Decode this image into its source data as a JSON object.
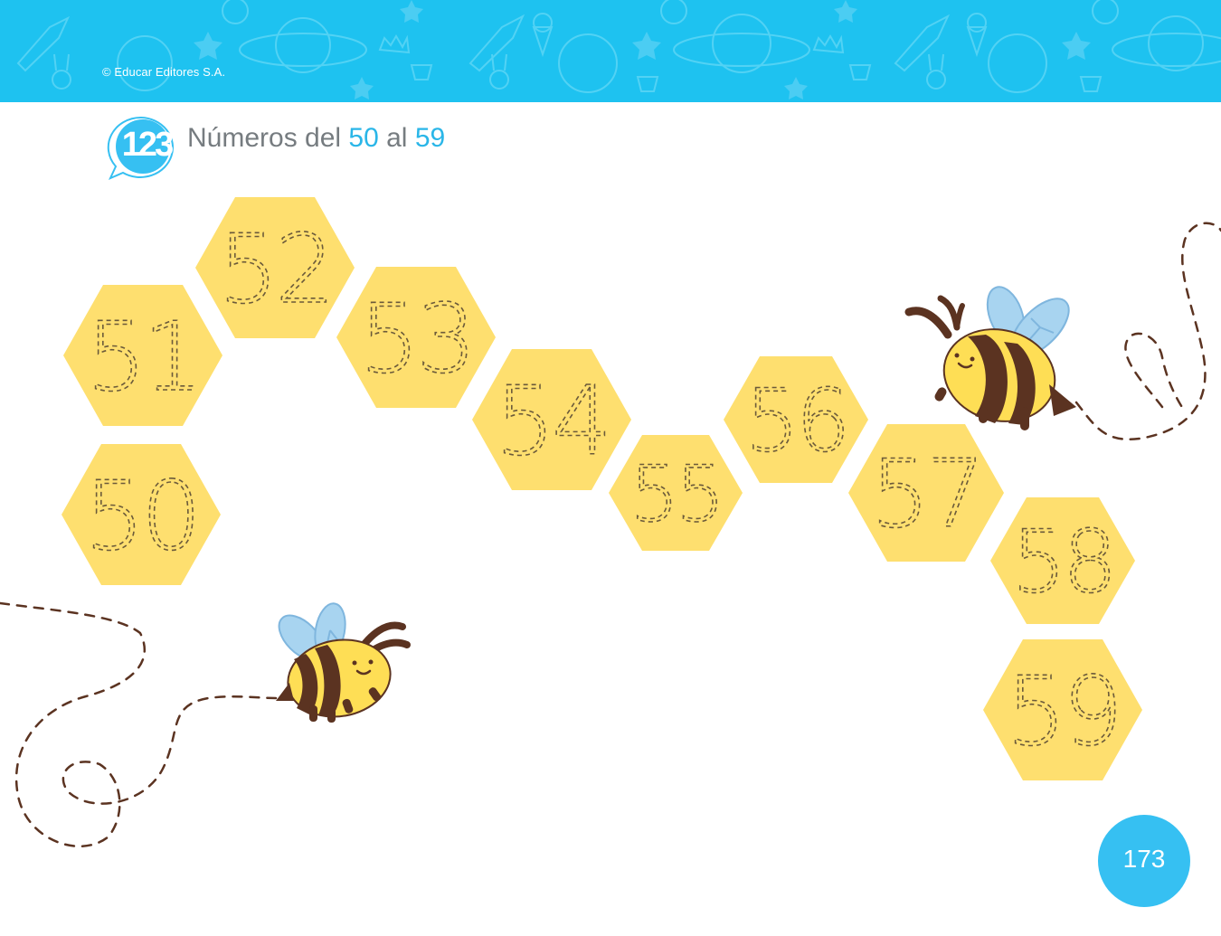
{
  "header": {
    "copyright": "© Educar Editores S.A.",
    "background_color": "#1ec2f0"
  },
  "badge": {
    "text": "123",
    "color": "#36c0f2"
  },
  "title": {
    "prefix": "Números del ",
    "first_number": "50",
    "middle": " al ",
    "last_number": "59"
  },
  "hexagons": {
    "fill_color": "#fedf6f",
    "items": [
      {
        "number": "50"
      },
      {
        "number": "51"
      },
      {
        "number": "52"
      },
      {
        "number": "53"
      },
      {
        "number": "54"
      },
      {
        "number": "55"
      },
      {
        "number": "56"
      },
      {
        "number": "57"
      },
      {
        "number": "58"
      },
      {
        "number": "59"
      }
    ]
  },
  "decorations": {
    "bees": 2,
    "bee_body_color": "#fede55",
    "bee_stripe_color": "#5b3321",
    "wing_color": "#a8d4f0"
  },
  "page_number": "173"
}
